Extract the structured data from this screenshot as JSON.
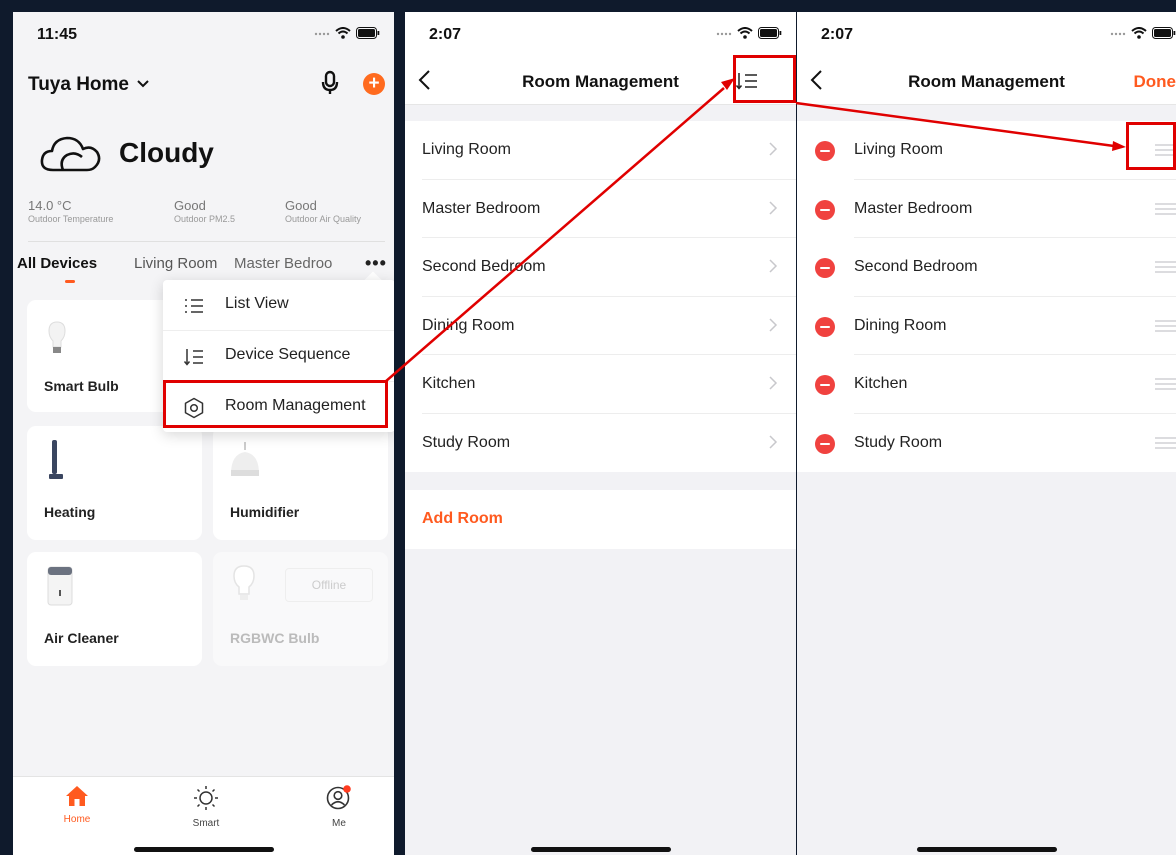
{
  "screens": [
    {
      "time": "11:45",
      "home": {
        "title": "Tuya Home"
      },
      "weather": {
        "condition": "Cloudy",
        "stats": [
          {
            "value": "14.0 °C",
            "label": "Outdoor Temperature"
          },
          {
            "value": "Good",
            "label": "Outdoor PM2.5"
          },
          {
            "value": "Good",
            "label": "Outdoor Air Quality"
          }
        ]
      },
      "tabs": [
        "All Devices",
        "Living Room",
        "Master Bedroo"
      ],
      "devices": [
        {
          "name": "Smart Bulb"
        },
        {
          "name": "Heating"
        },
        {
          "name": "Humidifier"
        },
        {
          "name": "Air Cleaner"
        },
        {
          "name": "RGBWC Bulb",
          "status": "Offline"
        }
      ],
      "menu": [
        "List View",
        "Device Sequence",
        "Room Management"
      ],
      "tabbar": [
        "Home",
        "Smart",
        "Me"
      ]
    },
    {
      "time": "2:07",
      "title": "Room Management",
      "rooms": [
        "Living Room",
        "Master Bedroom",
        "Second Bedroom",
        "Dining Room",
        "Kitchen",
        "Study Room"
      ],
      "add_room": "Add Room"
    },
    {
      "time": "2:07",
      "title": "Room Management",
      "done": "Done",
      "rooms": [
        "Living Room",
        "Master Bedroom",
        "Second Bedroom",
        "Dining Room",
        "Kitchen",
        "Study Room"
      ]
    }
  ],
  "colors": {
    "accent": "#ff5a1f",
    "delete": "#f0423f",
    "annotation": "#e00000",
    "background": "#0f1a2c"
  },
  "icons": [
    "signal-icon",
    "wifi-icon",
    "battery-icon",
    "chevron-down-icon",
    "microphone-icon",
    "plus-icon",
    "cloud-icon",
    "more-icon",
    "list-view-icon",
    "sort-icon",
    "settings-icon",
    "back-icon",
    "chevron-right-icon",
    "minus-icon",
    "drag-handle-icon",
    "home-icon",
    "smart-icon",
    "me-icon"
  ]
}
